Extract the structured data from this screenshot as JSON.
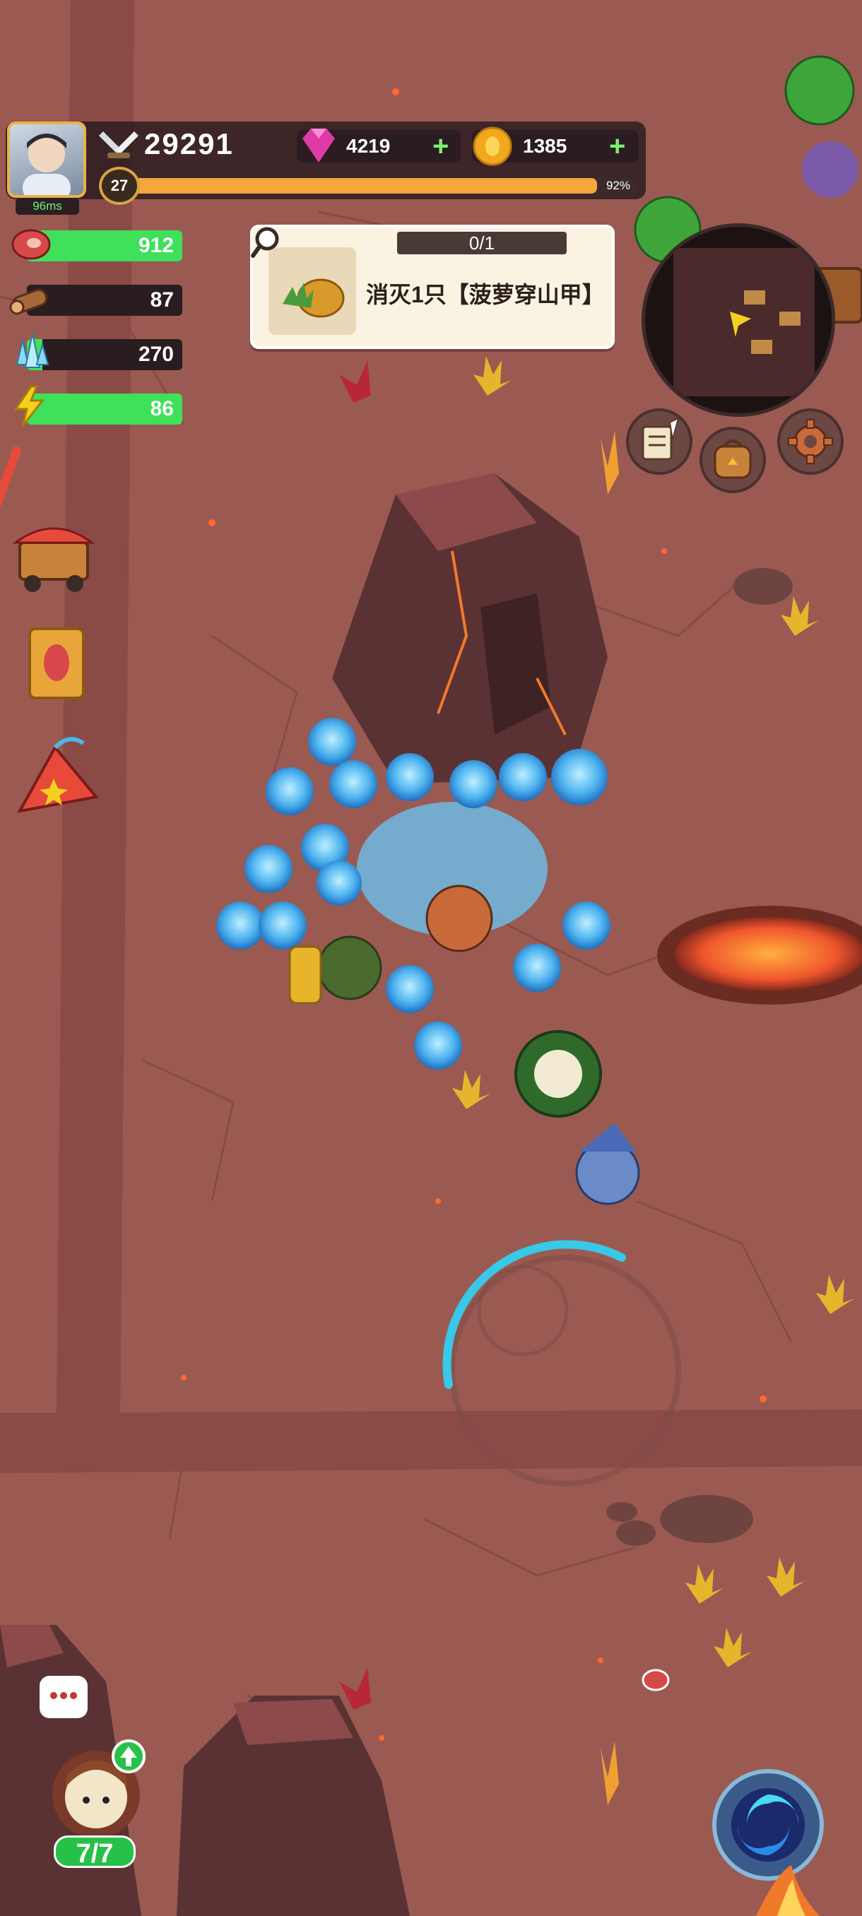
{
  "player": {
    "ping": "96ms",
    "power": "29291",
    "level": "27",
    "xp_percent_label": "92%",
    "xp_fraction": 0.92
  },
  "currency": {
    "gems": "4219",
    "gold": "1385"
  },
  "resources": [
    {
      "name": "meat",
      "icon": "meat-icon",
      "value": "912",
      "fill": 1.0
    },
    {
      "name": "wood",
      "icon": "wood-icon",
      "value": "87",
      "fill": 0.0
    },
    {
      "name": "crystal",
      "icon": "crystal-icon",
      "value": "270",
      "fill": 0.1
    },
    {
      "name": "energy",
      "icon": "lightning-icon",
      "value": "86",
      "fill": 1.0
    }
  ],
  "quest": {
    "progress": "0/1",
    "text": "消灭1只【菠萝穿山甲】"
  },
  "heroes": {
    "count": "7/7"
  },
  "colors": {
    "ground": "#9a5a52",
    "resource_fill": "#3fe05a",
    "xp_fill": "#f2a83a",
    "hero_badge": "#27c14a"
  }
}
